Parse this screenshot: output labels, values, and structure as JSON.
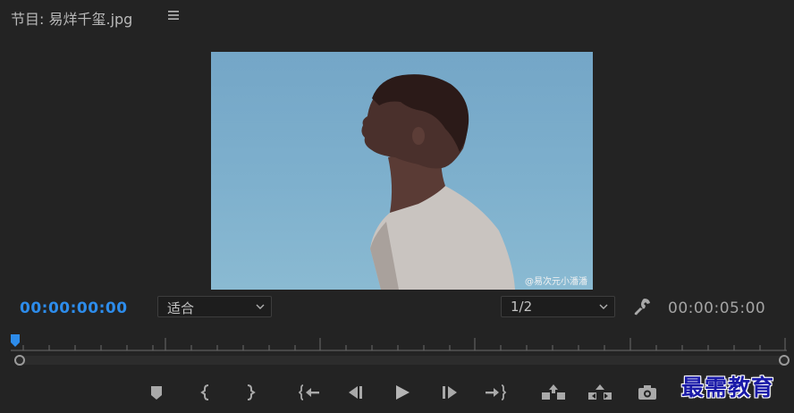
{
  "header": {
    "panel_title": "节目: 易烊千玺.jpg",
    "menu_icon": "hamburger-menu-icon"
  },
  "preview": {
    "watermark": "@易次元小潘潘",
    "background_color": "#7eb0cd"
  },
  "controls": {
    "current_timecode": "00:00:00:00",
    "zoom_select_value": "适合",
    "resolution_select_value": "1/2",
    "duration": "00:00:05:00",
    "settings_icon": "wrench-icon"
  },
  "transport": {
    "buttons": [
      {
        "name": "add-marker",
        "icon": "marker-icon"
      },
      {
        "name": "mark-in",
        "icon": "mark-in-icon"
      },
      {
        "name": "mark-out",
        "icon": "mark-out-icon"
      },
      {
        "name": "go-to-in",
        "icon": "go-to-in-icon"
      },
      {
        "name": "step-back",
        "icon": "step-back-icon"
      },
      {
        "name": "play",
        "icon": "play-icon"
      },
      {
        "name": "step-forward",
        "icon": "step-forward-icon"
      },
      {
        "name": "go-to-out",
        "icon": "go-to-out-icon"
      },
      {
        "name": "lift",
        "icon": "lift-icon"
      },
      {
        "name": "extract",
        "icon": "extract-icon"
      },
      {
        "name": "export-frame",
        "icon": "camera-icon"
      }
    ]
  },
  "overlay": {
    "logo_text": "最需教育"
  },
  "colors": {
    "accent_timecode": "#2d8ceb",
    "panel_bg": "#232323"
  }
}
